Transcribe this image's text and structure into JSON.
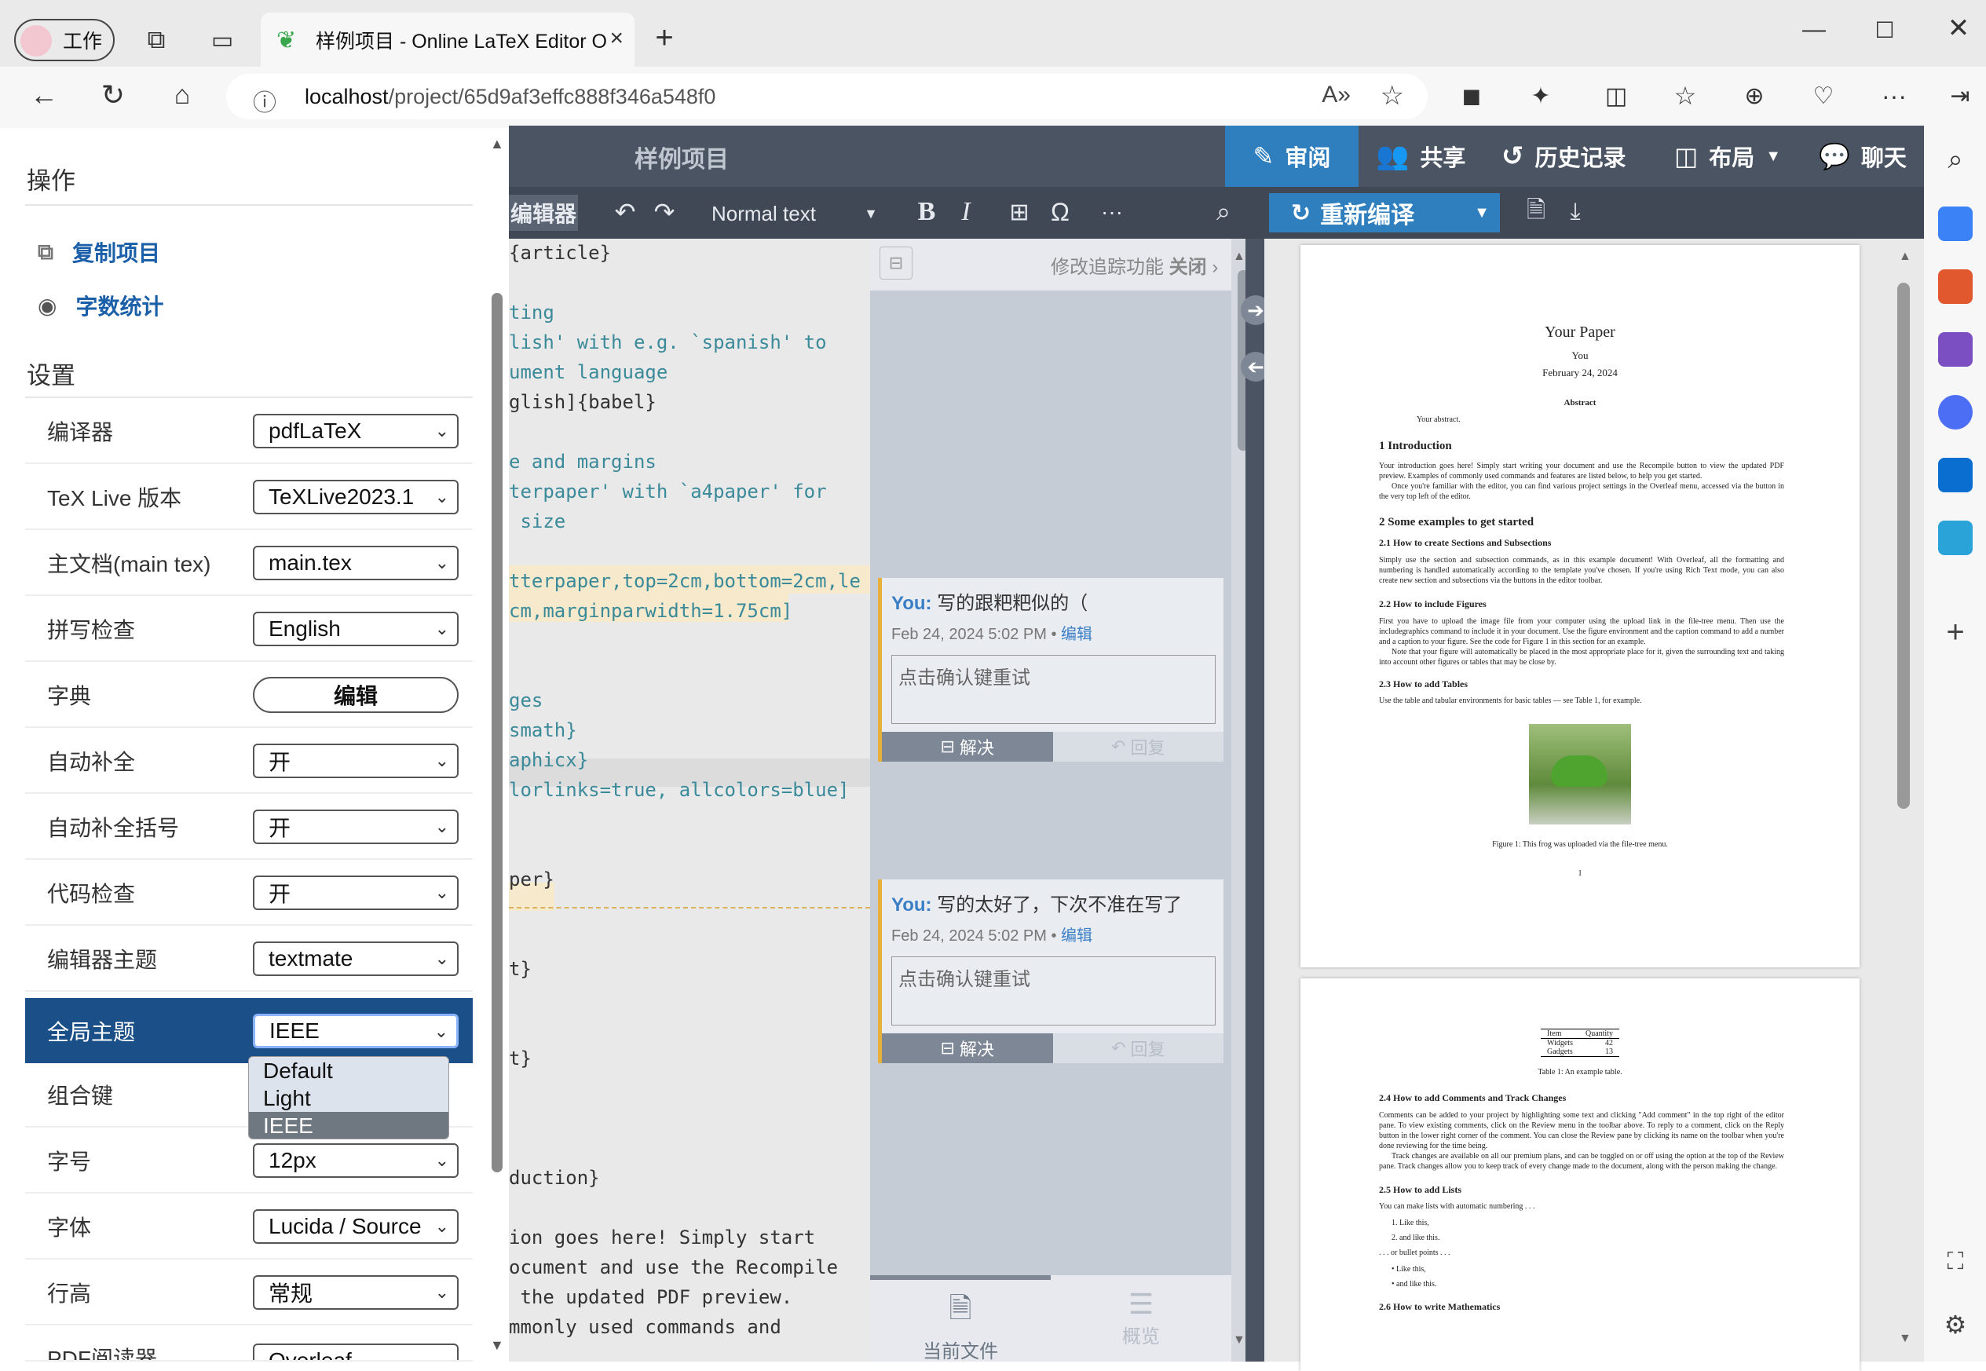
{
  "browser": {
    "workspace_label": "工作",
    "tab_title": "样例项目 - Online LaTeX Editor O",
    "url_host": "localhost",
    "url_path": "/project/65d9af3effc888f346a548f0"
  },
  "left_panel": {
    "actions_title": "操作",
    "actions": [
      {
        "label": "复制项目",
        "icon": "copy-icon"
      },
      {
        "label": "字数统计",
        "icon": "eye-icon"
      }
    ],
    "settings_title": "设置",
    "settings": [
      {
        "label": "编译器",
        "value": "pdfLaTeX"
      },
      {
        "label": "TeX Live 版本",
        "value": "TeXLive2023.1"
      },
      {
        "label": "主文档(main tex)",
        "value": "main.tex"
      },
      {
        "label": "拼写检查",
        "value": "English"
      },
      {
        "label": "字典",
        "value": "编辑"
      },
      {
        "label": "自动补全",
        "value": "开"
      },
      {
        "label": "自动补全括号",
        "value": "开"
      },
      {
        "label": "代码检查",
        "value": "开"
      },
      {
        "label": "编辑器主题",
        "value": "textmate"
      },
      {
        "label": "全局主题",
        "value": "IEEE"
      },
      {
        "label": "组合键",
        "value": ""
      },
      {
        "label": "字号",
        "value": "12px"
      },
      {
        "label": "字体",
        "value": "Lucida / Source"
      },
      {
        "label": "行高",
        "value": "常规"
      },
      {
        "label": "PDF阅读器",
        "value": "Overleaf"
      }
    ],
    "theme_options": [
      "Default",
      "Light",
      "IEEE"
    ]
  },
  "toolbar": {
    "project_title": "样例项目",
    "review": "审阅",
    "share": "共享",
    "history": "历史记录",
    "layout": "布局",
    "chat": "聊天",
    "editor_tab": "编辑器",
    "text_style": "Normal text",
    "recompile": "重新编译"
  },
  "editor_lines": [
    "{article}",
    "",
    "ting",
    "lish' with e.g. `spanish' to",
    "ument language",
    "glish]{babel}",
    "",
    "e and margins",
    "terpaper' with `a4paper' for",
    " size",
    "",
    "tterpaper,top=2cm,bottom=2cm,le",
    "cm,marginparwidth=1.75cm]",
    "",
    "",
    "ges",
    "smath}",
    "aphicx}",
    "lorlinks=true, allcolors=blue]",
    "",
    "",
    "per}",
    "",
    "",
    "t}",
    "",
    "",
    "t}",
    "",
    "",
    "",
    "duction}",
    "",
    "ion goes here! Simply start",
    "ocument and use the Recompile",
    " the updated PDF preview.",
    "mmonly used commands and"
  ],
  "review_panel": {
    "track_changes": "修改追踪功能",
    "track_state": "关闭",
    "comments": [
      {
        "author": "You:",
        "text": "写的跟粑粑似的（",
        "date": "Feb 24, 2024 5:02 PM •",
        "edit": "编辑",
        "placeholder": "点击确认键重试",
        "resolve": "解决",
        "reply": "回复"
      },
      {
        "author": "You:",
        "text": "写的太好了，下次不准在写了",
        "date": "Feb 24, 2024 5:02 PM •",
        "edit": "编辑",
        "placeholder": "点击确认键重试",
        "resolve": "解决",
        "reply": "回复"
      }
    ],
    "bottom_tabs": [
      "当前文件",
      "概览"
    ]
  },
  "pdf": {
    "title": "Your Paper",
    "author": "You",
    "date": "February 24, 2024",
    "abstract_title": "Abstract",
    "abstract": "Your abstract.",
    "s1": "1    Introduction",
    "s1_text": "Your introduction goes here! Simply start writing your document and use the Recompile button to view the updated PDF preview. Examples of commonly used commands and features are listed below, to help you get started.",
    "s1_text2": "Once you're familiar with the editor, you can find various project settings in the Overleaf menu, accessed via the button in the very top left of the editor.",
    "s2": "2    Some examples to get started",
    "s21": "2.1    How to create Sections and Subsections",
    "s21_text": "Simply use the section and subsection commands, as in this example document! With Overleaf, all the formatting and numbering is handled automatically according to the template you've chosen. If you're using Rich Text mode, you can also create new section and subsections via the buttons in the editor toolbar.",
    "s22": "2.2    How to include Figures",
    "s22_text": "First you have to upload the image file from your computer using the upload link in the file-tree menu. Then use the includegraphics command to include it in your document. Use the figure environment and the caption command to add a number and a caption to your figure. See the code for Figure 1 in this section for an example.",
    "s22_text2": "Note that your figure will automatically be placed in the most appropriate place for it, given the surrounding text and taking into account other figures or tables that may be close by.",
    "s23": "2.3    How to add Tables",
    "s23_text": "Use the table and tabular environments for basic tables — see Table 1, for example.",
    "fig_caption": "Figure 1: This frog was uploaded via the file-tree menu.",
    "page_num": "1",
    "table_head": [
      "Item",
      "Quantity"
    ],
    "table_rows": [
      [
        "Widgets",
        "42"
      ],
      [
        "Gadgets",
        "13"
      ]
    ],
    "table_caption": "Table 1: An example table.",
    "s24": "2.4    How to add Comments and Track Changes",
    "s24_text": "Comments can be added to your project by highlighting some text and clicking \"Add comment\" in the top right of the editor pane. To view existing comments, click on the Review menu in the toolbar above. To reply to a comment, click on the Reply button in the lower right corner of the comment. You can close the Review pane by clicking its name on the toolbar when you're done reviewing for the time being.",
    "s24_text2": "Track changes are available on all our premium plans, and can be toggled on or off using the option at the top of the Review pane. Track changes allow you to keep track of every change made to the document, along with the person making the change.",
    "s25": "2.5    How to add Lists",
    "s25_text": "You can make lists with automatic numbering . . .",
    "list_num": [
      "1. Like this,",
      "2. and like this."
    ],
    "bullet_intro": ". . . or bullet points . . .",
    "list_bullet": [
      "• Like this,",
      "• and like this."
    ],
    "s26": "2.6    How to write Mathematics"
  }
}
